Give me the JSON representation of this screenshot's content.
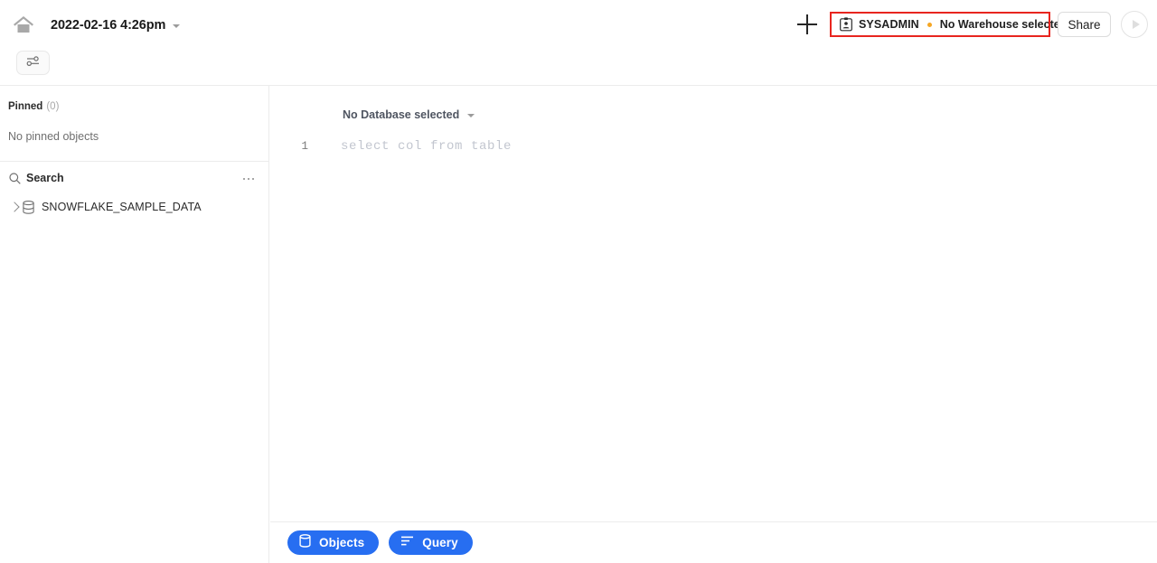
{
  "topbar": {
    "home_icon": "home-icon",
    "title": "2022-02-16 4:26pm",
    "title_caret": "chevron-down-icon",
    "add_icon": "plus-icon",
    "context": {
      "role_icon": "id-badge-icon",
      "role": "SYSADMIN",
      "status_dot_color": "#f5a623",
      "warehouse": "No Warehouse selected",
      "annotation_color": "#e8251f"
    },
    "share_label": "Share",
    "run_icon": "play-icon",
    "filter_icon": "sliders-icon"
  },
  "sidebar": {
    "pinned_label": "Pinned",
    "pinned_count": "(0)",
    "pinned_empty": "No pinned objects",
    "search_icon": "search-icon",
    "search_label": "Search",
    "more_icon": "ellipsis-icon",
    "tree": [
      {
        "chevron": "chevron-right-icon",
        "icon": "database-icon",
        "label": "SNOWFLAKE_SAMPLE_DATA"
      }
    ]
  },
  "main": {
    "database_selector": "No Database selected",
    "database_caret": "chevron-down-icon",
    "editor": {
      "line_number": "1",
      "placeholder": "select col from table"
    },
    "bottom_tabs": [
      {
        "label": "Objects",
        "icon": "database-icon"
      },
      {
        "label": "Query",
        "icon": "query-lines-icon"
      }
    ],
    "accent_color": "#276ef1"
  }
}
